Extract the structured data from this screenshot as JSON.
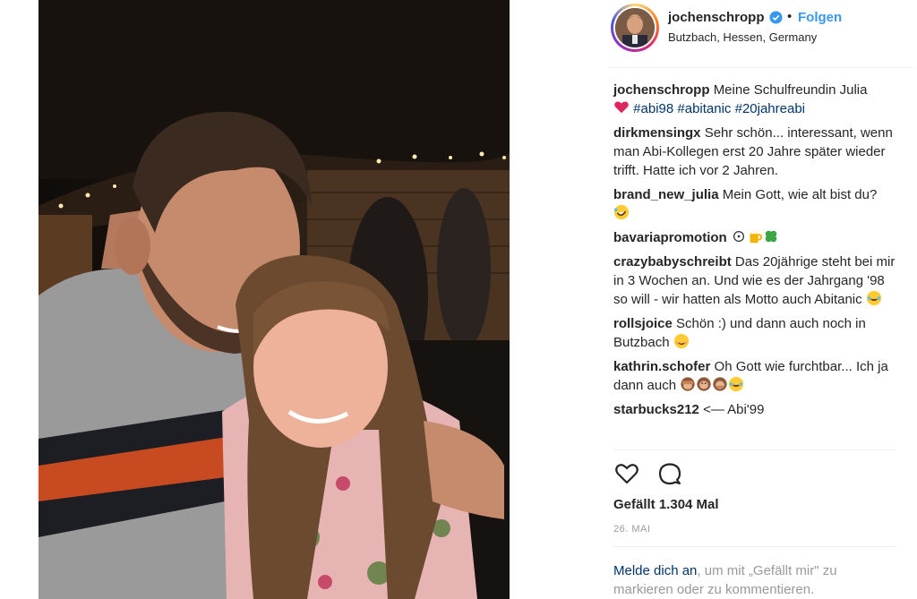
{
  "post": {
    "photo_alt": "",
    "header": {
      "username": "jochenschropp",
      "dot": "•",
      "follow_label": "Folgen",
      "location": "Butzbach, Hessen, Germany"
    },
    "caption": {
      "username": "jochenschropp",
      "text": "Meine Schulfreundin Julia",
      "hashtags": [
        "#abi98",
        "#abitanic",
        "#20jahreabi"
      ]
    },
    "comments": [
      {
        "username": "dirkmensingx",
        "text": "Sehr schön... interessant, wenn man Abi-Kollegen erst 20 Jahre später wieder trifft. Hatte ich vor 2 Jahren."
      },
      {
        "username": "brand_new_julia",
        "text": "Mein Gott, wie alt bist du?"
      },
      {
        "username": "bavariapromotion",
        "text": ""
      },
      {
        "username": "crazybabyschreibt",
        "text": "Das 20jährige steht bei mir in 3 Wochen an. Und wie es der Jahrgang '98 so will - wir hatten als Motto auch Abitanic"
      },
      {
        "username": "rollsjoice",
        "text": "Schön :) und dann auch noch in Butzbach"
      },
      {
        "username": "kathrin.schofer",
        "text": "Oh Gott wie furchtbar... Ich ja dann auch"
      },
      {
        "username": "starbucks212",
        "text": "<— Abi'99"
      }
    ],
    "likes_text": "Gefällt 1.304 Mal",
    "date": "26. MAI",
    "login_prompt": {
      "link": "Melde dich an",
      "rest": ", um mit „Gefällt mir\" zu markieren oder zu kommentieren."
    },
    "icons": {
      "verified": "verified-badge-icon",
      "like": "heart-outline-icon",
      "comment": "comment-bubble-icon",
      "heart_emoji": "red-heart-emoji",
      "laugh_emoji": "rofl-emoji",
      "face_emoji": "smiling-face-emoji",
      "monkey_emoji": "see-no-evil-monkey-emoji"
    },
    "colors": {
      "accent": "#3897f0",
      "hashtag": "#003569",
      "muted": "#999999",
      "text": "#262626"
    }
  }
}
